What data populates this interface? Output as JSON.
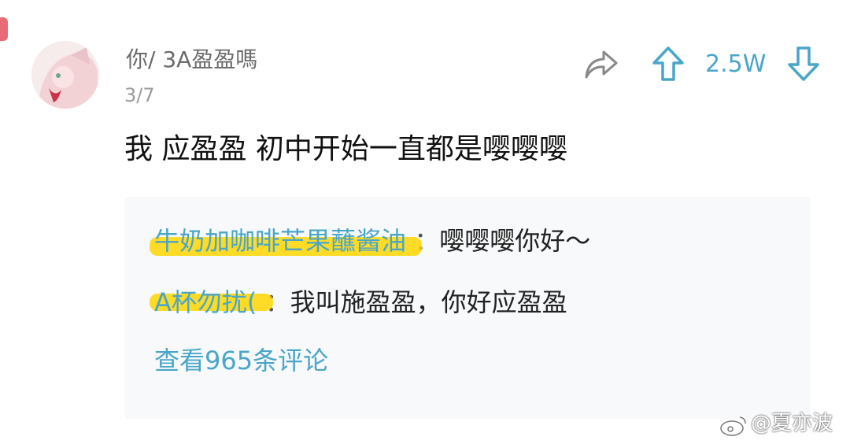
{
  "comment": {
    "username": "你/ 3A盈盈嗎",
    "date": "3/7",
    "text": "我 应盈盈 初中开始一直都是嘤嘤嘤",
    "votes": "2.5W"
  },
  "replies": [
    {
      "name": "牛奶加咖啡芒果蘸酱油",
      "sep": "：",
      "body": "嘤嘤嘤你好～"
    },
    {
      "name": "A杯勿扰(",
      "sep": "：",
      "body": "我叫施盈盈，你好应盈盈"
    }
  ],
  "view_more": "查看965条评论",
  "watermark": {
    "prefix": "@",
    "author": "夏亦波",
    "icon": "weibo-icon"
  },
  "colors": {
    "accent": "#4aa6c9",
    "highlight": "#ffd600"
  }
}
